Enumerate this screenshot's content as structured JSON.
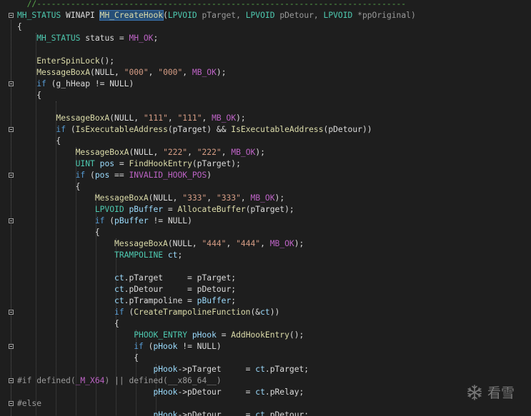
{
  "editor": {
    "lines": [
      {
        "tokens": [
          {
            "t": "  //----------------------------------------------------------------------------",
            "c": "comment"
          }
        ],
        "fold": false
      },
      {
        "tokens": [
          {
            "t": "MH_STATUS",
            "c": "type"
          },
          {
            "t": " WINAPI ",
            "c": "plain"
          },
          {
            "t": "MH_CreateHook",
            "c": "hl"
          },
          {
            "t": "(",
            "c": "plain"
          },
          {
            "t": "LPVOID",
            "c": "type"
          },
          {
            "t": " pTarget, ",
            "c": "param"
          },
          {
            "t": "LPVOID",
            "c": "type"
          },
          {
            "t": " pDetour, ",
            "c": "param"
          },
          {
            "t": "LPVOID",
            "c": "type"
          },
          {
            "t": " *ppOriginal)",
            "c": "param"
          }
        ],
        "fold": true
      },
      {
        "tokens": [
          {
            "t": "{",
            "c": "plain"
          }
        ],
        "fold": false
      },
      {
        "tokens": [
          {
            "t": "    ",
            "c": "plain"
          },
          {
            "t": "MH_STATUS",
            "c": "type"
          },
          {
            "t": " status = ",
            "c": "plain"
          },
          {
            "t": "MH_OK",
            "c": "macro"
          },
          {
            "t": ";",
            "c": "plain"
          }
        ],
        "fold": false
      },
      {
        "tokens": [],
        "fold": false
      },
      {
        "tokens": [
          {
            "t": "    ",
            "c": "plain"
          },
          {
            "t": "EnterSpinLock",
            "c": "func"
          },
          {
            "t": "();",
            "c": "plain"
          }
        ],
        "fold": false
      },
      {
        "tokens": [
          {
            "t": "    ",
            "c": "plain"
          },
          {
            "t": "MessageBoxA",
            "c": "func"
          },
          {
            "t": "(NULL, ",
            "c": "plain"
          },
          {
            "t": "\"000\"",
            "c": "string"
          },
          {
            "t": ", ",
            "c": "plain"
          },
          {
            "t": "\"000\"",
            "c": "string"
          },
          {
            "t": ", ",
            "c": "plain"
          },
          {
            "t": "MB_OK",
            "c": "macro"
          },
          {
            "t": ");",
            "c": "plain"
          }
        ],
        "fold": false
      },
      {
        "tokens": [
          {
            "t": "    ",
            "c": "plain"
          },
          {
            "t": "if",
            "c": "keyword"
          },
          {
            "t": " (g_hHeap != NULL)",
            "c": "plain"
          }
        ],
        "fold": true
      },
      {
        "tokens": [
          {
            "t": "    {",
            "c": "plain"
          }
        ],
        "fold": false
      },
      {
        "tokens": [],
        "fold": false
      },
      {
        "tokens": [
          {
            "t": "        ",
            "c": "plain"
          },
          {
            "t": "MessageBoxA",
            "c": "func"
          },
          {
            "t": "(NULL, ",
            "c": "plain"
          },
          {
            "t": "\"111\"",
            "c": "string"
          },
          {
            "t": ", ",
            "c": "plain"
          },
          {
            "t": "\"111\"",
            "c": "string"
          },
          {
            "t": ", ",
            "c": "plain"
          },
          {
            "t": "MB_OK",
            "c": "macro"
          },
          {
            "t": ");",
            "c": "plain"
          }
        ],
        "fold": false
      },
      {
        "tokens": [
          {
            "t": "        ",
            "c": "plain"
          },
          {
            "t": "if",
            "c": "keyword"
          },
          {
            "t": " (",
            "c": "plain"
          },
          {
            "t": "IsExecutableAddress",
            "c": "func"
          },
          {
            "t": "(pTarget) && ",
            "c": "plain"
          },
          {
            "t": "IsExecutableAddress",
            "c": "func"
          },
          {
            "t": "(pDetour))",
            "c": "plain"
          }
        ],
        "fold": true
      },
      {
        "tokens": [
          {
            "t": "        {",
            "c": "plain"
          }
        ],
        "fold": false
      },
      {
        "tokens": [
          {
            "t": "            ",
            "c": "plain"
          },
          {
            "t": "MessageBoxA",
            "c": "func"
          },
          {
            "t": "(NULL, ",
            "c": "plain"
          },
          {
            "t": "\"222\"",
            "c": "string"
          },
          {
            "t": ", ",
            "c": "plain"
          },
          {
            "t": "\"222\"",
            "c": "string"
          },
          {
            "t": ", ",
            "c": "plain"
          },
          {
            "t": "MB_OK",
            "c": "macro"
          },
          {
            "t": ");",
            "c": "plain"
          }
        ],
        "fold": false
      },
      {
        "tokens": [
          {
            "t": "            ",
            "c": "plain"
          },
          {
            "t": "UINT",
            "c": "type"
          },
          {
            "t": " ",
            "c": "plain"
          },
          {
            "t": "pos",
            "c": "local"
          },
          {
            "t": " = ",
            "c": "plain"
          },
          {
            "t": "FindHookEntry",
            "c": "func"
          },
          {
            "t": "(pTarget);",
            "c": "plain"
          }
        ],
        "fold": false
      },
      {
        "tokens": [
          {
            "t": "            ",
            "c": "plain"
          },
          {
            "t": "if",
            "c": "keyword"
          },
          {
            "t": " (",
            "c": "plain"
          },
          {
            "t": "pos",
            "c": "local"
          },
          {
            "t": " == ",
            "c": "plain"
          },
          {
            "t": "INVALID_HOOK_POS",
            "c": "macro"
          },
          {
            "t": ")",
            "c": "plain"
          }
        ],
        "fold": true
      },
      {
        "tokens": [
          {
            "t": "            {",
            "c": "plain"
          }
        ],
        "fold": false
      },
      {
        "tokens": [
          {
            "t": "                ",
            "c": "plain"
          },
          {
            "t": "MessageBoxA",
            "c": "func"
          },
          {
            "t": "(NULL, ",
            "c": "plain"
          },
          {
            "t": "\"333\"",
            "c": "string"
          },
          {
            "t": ", ",
            "c": "plain"
          },
          {
            "t": "\"333\"",
            "c": "string"
          },
          {
            "t": ", ",
            "c": "plain"
          },
          {
            "t": "MB_OK",
            "c": "macro"
          },
          {
            "t": ");",
            "c": "plain"
          }
        ],
        "fold": false
      },
      {
        "tokens": [
          {
            "t": "                ",
            "c": "plain"
          },
          {
            "t": "LPVOID",
            "c": "type"
          },
          {
            "t": " ",
            "c": "plain"
          },
          {
            "t": "pBuffer",
            "c": "local"
          },
          {
            "t": " = ",
            "c": "plain"
          },
          {
            "t": "AllocateBuffer",
            "c": "func"
          },
          {
            "t": "(pTarget);",
            "c": "plain"
          }
        ],
        "fold": false
      },
      {
        "tokens": [
          {
            "t": "                ",
            "c": "plain"
          },
          {
            "t": "if",
            "c": "keyword"
          },
          {
            "t": " (",
            "c": "plain"
          },
          {
            "t": "pBuffer",
            "c": "local"
          },
          {
            "t": " != NULL)",
            "c": "plain"
          }
        ],
        "fold": true
      },
      {
        "tokens": [
          {
            "t": "                {",
            "c": "plain"
          }
        ],
        "fold": false
      },
      {
        "tokens": [
          {
            "t": "                    ",
            "c": "plain"
          },
          {
            "t": "MessageBoxA",
            "c": "func"
          },
          {
            "t": "(NULL, ",
            "c": "plain"
          },
          {
            "t": "\"444\"",
            "c": "string"
          },
          {
            "t": ", ",
            "c": "plain"
          },
          {
            "t": "\"444\"",
            "c": "string"
          },
          {
            "t": ", ",
            "c": "plain"
          },
          {
            "t": "MB_OK",
            "c": "macro"
          },
          {
            "t": ");",
            "c": "plain"
          }
        ],
        "fold": false
      },
      {
        "tokens": [
          {
            "t": "                    ",
            "c": "plain"
          },
          {
            "t": "TRAMPOLINE",
            "c": "type"
          },
          {
            "t": " ",
            "c": "plain"
          },
          {
            "t": "ct",
            "c": "local"
          },
          {
            "t": ";",
            "c": "plain"
          }
        ],
        "fold": false
      },
      {
        "tokens": [],
        "fold": false
      },
      {
        "tokens": [
          {
            "t": "                    ",
            "c": "plain"
          },
          {
            "t": "ct",
            "c": "local"
          },
          {
            "t": ".pTarget     = pTarget;",
            "c": "plain"
          }
        ],
        "fold": false
      },
      {
        "tokens": [
          {
            "t": "                    ",
            "c": "plain"
          },
          {
            "t": "ct",
            "c": "local"
          },
          {
            "t": ".pDetour     = pDetour;",
            "c": "plain"
          }
        ],
        "fold": false
      },
      {
        "tokens": [
          {
            "t": "                    ",
            "c": "plain"
          },
          {
            "t": "ct",
            "c": "local"
          },
          {
            "t": ".pTrampoline = ",
            "c": "plain"
          },
          {
            "t": "pBuffer",
            "c": "local"
          },
          {
            "t": ";",
            "c": "plain"
          }
        ],
        "fold": false
      },
      {
        "tokens": [
          {
            "t": "                    ",
            "c": "plain"
          },
          {
            "t": "if",
            "c": "keyword"
          },
          {
            "t": " (",
            "c": "plain"
          },
          {
            "t": "CreateTrampolineFunction",
            "c": "func"
          },
          {
            "t": "(&",
            "c": "plain"
          },
          {
            "t": "ct",
            "c": "local"
          },
          {
            "t": "))",
            "c": "plain"
          }
        ],
        "fold": true
      },
      {
        "tokens": [
          {
            "t": "                    {",
            "c": "plain"
          }
        ],
        "fold": false
      },
      {
        "tokens": [
          {
            "t": "                        ",
            "c": "plain"
          },
          {
            "t": "PHOOK_ENTRY",
            "c": "type"
          },
          {
            "t": " ",
            "c": "plain"
          },
          {
            "t": "pHook",
            "c": "local"
          },
          {
            "t": " = ",
            "c": "plain"
          },
          {
            "t": "AddHookEntry",
            "c": "func"
          },
          {
            "t": "();",
            "c": "plain"
          }
        ],
        "fold": false
      },
      {
        "tokens": [
          {
            "t": "                        ",
            "c": "plain"
          },
          {
            "t": "if",
            "c": "keyword"
          },
          {
            "t": " (",
            "c": "plain"
          },
          {
            "t": "pHook",
            "c": "local"
          },
          {
            "t": " != NULL)",
            "c": "plain"
          }
        ],
        "fold": true
      },
      {
        "tokens": [
          {
            "t": "                        {",
            "c": "plain"
          }
        ],
        "fold": false
      },
      {
        "tokens": [
          {
            "t": "                            ",
            "c": "plain"
          },
          {
            "t": "pHook",
            "c": "local"
          },
          {
            "t": "->pTarget     = ",
            "c": "plain"
          },
          {
            "t": "ct",
            "c": "local"
          },
          {
            "t": ".pTarget;",
            "c": "plain"
          }
        ],
        "fold": false
      },
      {
        "tokens": [
          {
            "t": "#if defined(",
            "c": "pre"
          },
          {
            "t": "_M_X64",
            "c": "macro"
          },
          {
            "t": ") || defined(__x86_64__)",
            "c": "pre"
          }
        ],
        "fold": true
      },
      {
        "tokens": [
          {
            "t": "                            ",
            "c": "plain"
          },
          {
            "t": "pHook",
            "c": "local"
          },
          {
            "t": "->pDetour     = ",
            "c": "plain"
          },
          {
            "t": "ct",
            "c": "local"
          },
          {
            "t": ".pRelay;",
            "c": "plain"
          }
        ],
        "fold": false
      },
      {
        "tokens": [
          {
            "t": "#else",
            "c": "pre"
          }
        ],
        "fold": true
      },
      {
        "tokens": [
          {
            "t": "                            ",
            "c": "plain"
          },
          {
            "t": "pHook",
            "c": "local"
          },
          {
            "t": "->pDetour     = ",
            "c": "plain"
          },
          {
            "t": "ct",
            "c": "local"
          },
          {
            "t": ".pDetour;",
            "c": "plain"
          }
        ],
        "fold": false
      }
    ]
  },
  "watermark": {
    "text": "看雪",
    "icon": "snowflake-icon"
  },
  "colors": {
    "background": "#1e1e1e",
    "selection": "#264f78"
  }
}
